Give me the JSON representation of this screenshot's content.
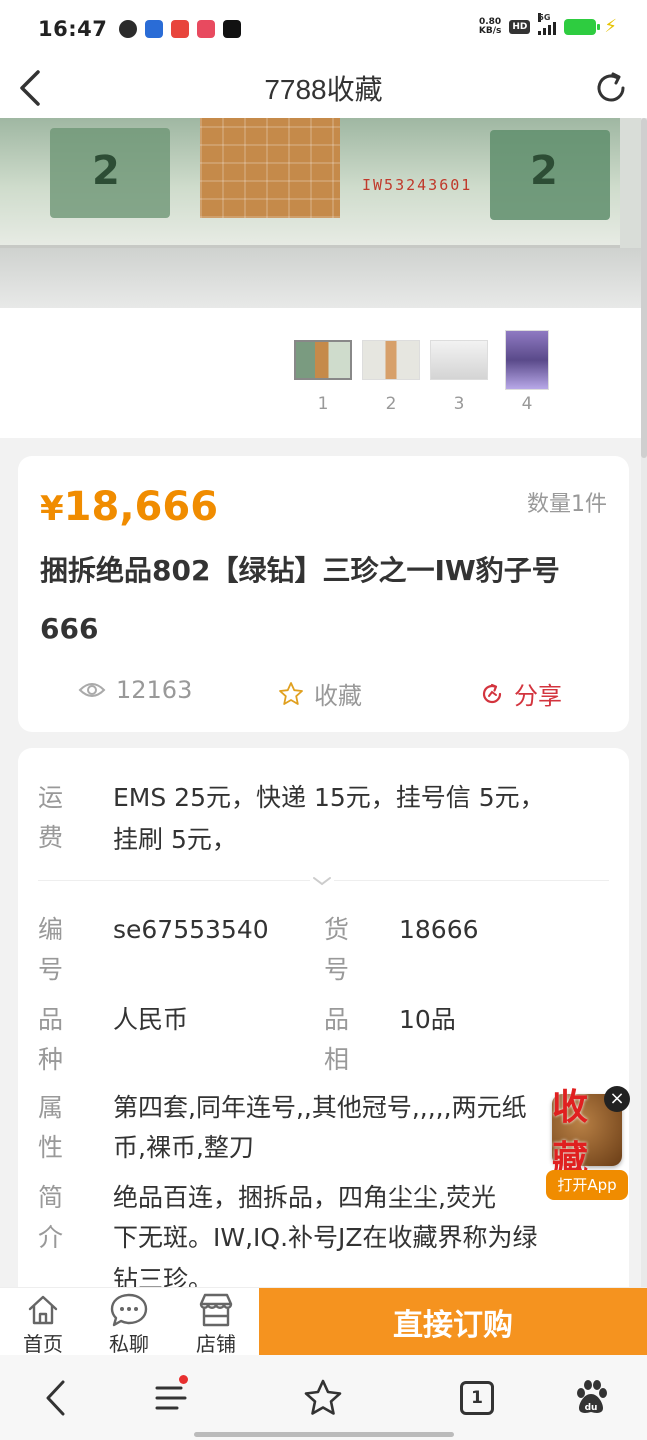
{
  "status_bar": {
    "time": "16:47",
    "net_speed_value": "0.80",
    "net_speed_unit": "KB/s",
    "hd": "HD",
    "network": "5G",
    "icons": [
      "wechat-icon",
      "baidu-paw-icon",
      "map-icon",
      "shop-icon",
      "capcut-icon"
    ]
  },
  "header": {
    "title": "7788收藏"
  },
  "gallery": {
    "serial": "IW53243601",
    "thumbnails": [
      {
        "label": "1"
      },
      {
        "label": "2"
      },
      {
        "label": "3"
      },
      {
        "label": "4"
      }
    ]
  },
  "product": {
    "price_symbol": "¥",
    "price": "18,666",
    "quantity": "数量1件",
    "title": "捆拆绝品802【绿钻】三珍之一IW豹子号666",
    "views": "12163",
    "favorite_label": "收藏",
    "share_label": "分享"
  },
  "details": {
    "shipping": {
      "label": "运费",
      "value_line1": "EMS 25元，快递 15元，挂号信 5元，",
      "value_line2": "挂刷 5元，"
    },
    "number": {
      "label": "编号",
      "value": "se67553540"
    },
    "item_no": {
      "label": "货号",
      "value": "18666"
    },
    "category": {
      "label": "品种",
      "value": "人民币"
    },
    "grade": {
      "label": "品相",
      "value": "10品"
    },
    "attributes": {
      "label": "属性",
      "value_line1": "第四套,同年连号,,其他冠号,,,,,两元纸",
      "value_line2": "币,裸币,整刀"
    },
    "intro": {
      "label": "简介",
      "value_line1": "绝品百连，捆拆品，四角尘尘,荧光",
      "value_line2": "下无斑。IW,IQ.补号JZ在收藏界称为绿",
      "value_line3": "钻三珍。"
    }
  },
  "floating_app": {
    "logo_text": "收藏",
    "button": "打开App",
    "close": "×"
  },
  "action_bar": {
    "home": "首页",
    "chat": "私聊",
    "shop": "店铺",
    "buy": "直接订购"
  },
  "browser_nav": {
    "tab_count": "1"
  },
  "colors": {
    "accent": "#f08c00",
    "buy_button": "#f5931f",
    "share": "#d3343e"
  }
}
